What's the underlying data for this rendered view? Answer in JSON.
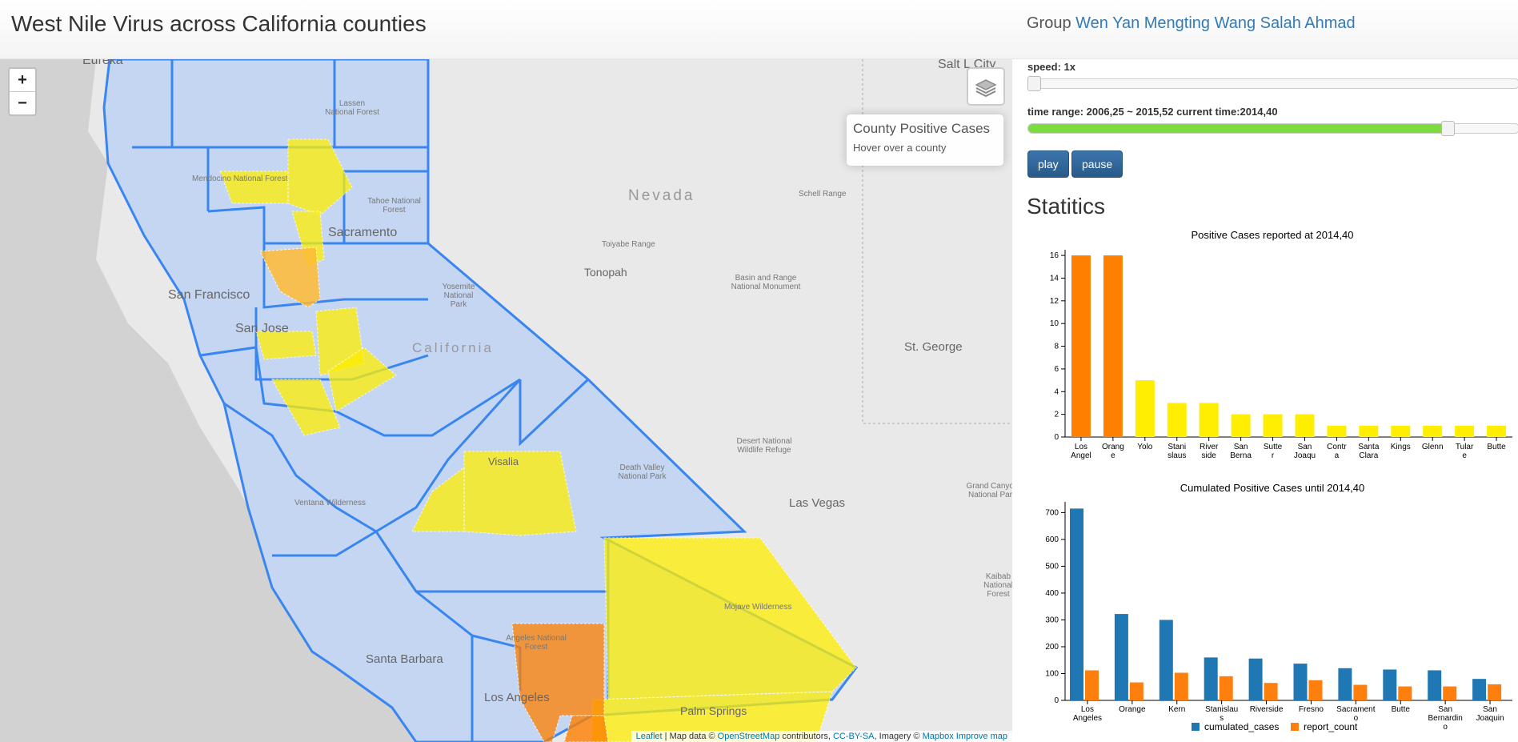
{
  "header": {
    "title": "West Nile Virus across California counties",
    "group_label": "Group",
    "group_names": "Wen Yan Mengting Wang Salah Ahmad"
  },
  "map": {
    "zoom_in": "+",
    "zoom_out": "−",
    "info_title": "County Positive Cases",
    "info_hint": "Hover over a county",
    "attribution": {
      "leaflet": "Leaflet",
      "sep": " | Map data © ",
      "osm": "OpenStreetMap",
      "contributors": " contributors, ",
      "license": "CC-BY-SA",
      "imagery": ", Imagery © ",
      "mapbox": "Mapbox Improve map"
    },
    "labels": {
      "eureka": "Eureka",
      "salt_lake": "Salt L  City",
      "lassen": "Lassen National Forest",
      "mendocino": "Mendocino National Forest",
      "tahoe": "Tahoe National Forest",
      "nevada": "Nevada",
      "schell": "Schell Range",
      "toiyabe": "Toiyabe Range",
      "sacramento": "Sacramento",
      "tonopah": "Tonopah",
      "basin_range": "Basin and Range National Monument",
      "yosemite": "Yosemite National Park",
      "san_francisco": "San Francisco",
      "san_jose": "San Jose",
      "california": "California",
      "st_george": "St. George",
      "desert_refuge": "Desert National Wildlife Refuge",
      "death_valley": "Death Valley National Park",
      "visalia": "Visalia",
      "grand_canyon": "Grand Canyon National Park",
      "ventana": "Ventana Wilderness",
      "las_vegas": "Las Vegas",
      "mojave": "Mojave Wilderness",
      "kaibab": "Kaibab National Forest",
      "angeles": "Angeles National Forest",
      "santa_barbara": "Santa Barbara",
      "los_angeles": "Los Angeles",
      "palm_springs": "Palm Springs"
    }
  },
  "controls": {
    "speed_label": "speed: 1x",
    "speed_value": 0,
    "time_label": "time range: 2006,25 ~ 2015,52 current time:2014,40",
    "time_progress": 0.855,
    "play_label": "play",
    "pause_label": "pause"
  },
  "stats": {
    "title": "Statitics"
  },
  "colors": {
    "county_default": "#c5d6f2",
    "county_border": "#3a86f0",
    "high": "#ff8000",
    "low": "#ffee00",
    "cumulated": "#1f77b4",
    "report": "#ff7f0e",
    "slider_fill": "#7cdc3f",
    "link": "#337ab7"
  },
  "chart_data": [
    {
      "type": "bar",
      "title": "Positive Cases reported at 2014,40",
      "categories": [
        "Los Angel",
        "Orang e",
        "Yolo",
        "Stani slaus",
        "River side",
        "San Berna",
        "Sutte r",
        "San Joaqu",
        "Contr a",
        "Santa Clara",
        "Kings",
        "Glenn",
        "Tular e",
        "Butte"
      ],
      "values": [
        16,
        16,
        5,
        3,
        3,
        2,
        2,
        2,
        1,
        1,
        1,
        1,
        1,
        1
      ],
      "bar_colors": [
        "#ff8000",
        "#ff8000",
        "#ffee00",
        "#ffee00",
        "#ffee00",
        "#ffee00",
        "#ffee00",
        "#ffee00",
        "#ffee00",
        "#ffee00",
        "#ffee00",
        "#ffee00",
        "#ffee00",
        "#ffee00"
      ],
      "yticks": [
        0,
        2,
        4,
        6,
        8,
        10,
        12,
        14,
        16
      ],
      "ylim": [
        0,
        16.5
      ]
    },
    {
      "type": "bar",
      "title": "Cumulated Positive Cases until 2014,40",
      "categories": [
        "Los Angeles",
        "Orange",
        "Kern",
        "Stanislau s",
        "Riverside",
        "Fresno",
        "Sacrament o",
        "Butte",
        "San Bernardin o",
        "San Joaquin"
      ],
      "series": [
        {
          "name": "cumulated_cases",
          "values": [
            715,
            322,
            300,
            160,
            156,
            137,
            120,
            115,
            112,
            80
          ]
        },
        {
          "name": "report_count",
          "values": [
            112,
            67,
            103,
            90,
            65,
            75,
            58,
            52,
            52,
            60
          ]
        }
      ],
      "yticks": [
        0,
        100,
        200,
        300,
        400,
        500,
        600,
        700
      ],
      "ylim": [
        0,
        740
      ],
      "legend": "bottom"
    }
  ]
}
